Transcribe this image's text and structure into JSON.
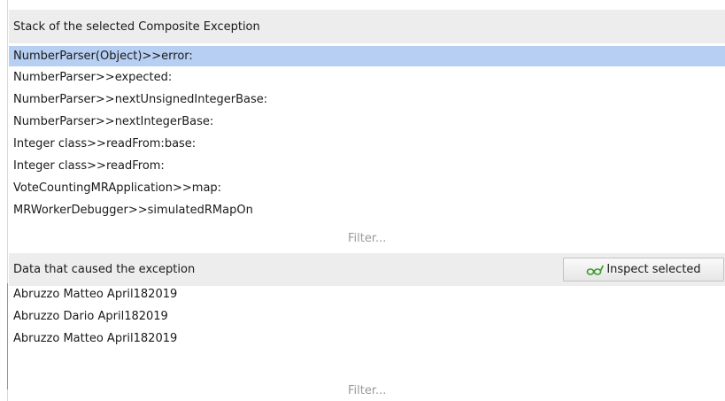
{
  "stack_section": {
    "title": "Stack of the selected Composite Exception",
    "items": [
      "NumberParser(Object)>>error:",
      "NumberParser>>expected:",
      "NumberParser>>nextUnsignedIntegerBase:",
      "NumberParser>>nextIntegerBase:",
      "Integer class>>readFrom:base:",
      "Integer class>>readFrom:",
      "VoteCountingMRApplication>>map:",
      "MRWorkerDebugger>>simulatedRMapOn"
    ],
    "selected_index": 0,
    "filter_placeholder": "Filter..."
  },
  "data_section": {
    "title": "Data that caused the exception",
    "inspect_button_label": "Inspect selected",
    "inspect_button_icon": "glasses-icon",
    "items": [
      "Abruzzo Matteo April182019",
      "Abruzzo Dario April182019",
      "Abruzzo Matteo April182019"
    ],
    "filter_placeholder": "Filter..."
  },
  "colors": {
    "header_bg": "#ededed",
    "selection_bg": "#b7cff2",
    "icon_green": "#3f9a2e"
  }
}
